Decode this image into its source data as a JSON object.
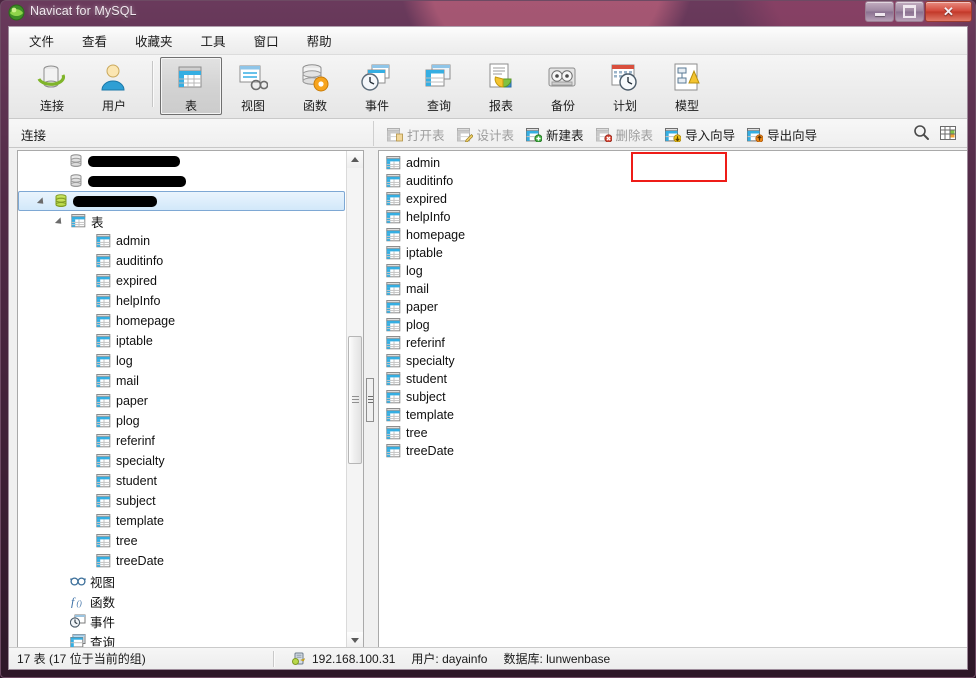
{
  "window": {
    "title": "Navicat for MySQL",
    "app_icon": "navicat-logo-icon",
    "minimize_label": "最小化",
    "restore_label": "还原",
    "close_label": "关闭"
  },
  "menubar": {
    "items": [
      {
        "label": "文件",
        "name": "menu-file"
      },
      {
        "label": "查看",
        "name": "menu-view"
      },
      {
        "label": "收藏夹",
        "name": "menu-favorites"
      },
      {
        "label": "工具",
        "name": "menu-tools"
      },
      {
        "label": "窗口",
        "name": "menu-window"
      },
      {
        "label": "帮助",
        "name": "menu-help"
      }
    ]
  },
  "toolbar": {
    "items": [
      {
        "label": "连接",
        "icon": "connection-icon",
        "selected": false
      },
      {
        "label": "用户",
        "icon": "user-icon",
        "selected": false
      },
      {
        "label": "表",
        "icon": "table-icon",
        "selected": true
      },
      {
        "label": "视图",
        "icon": "view-icon",
        "selected": false
      },
      {
        "label": "函数",
        "icon": "function-icon",
        "selected": false
      },
      {
        "label": "事件",
        "icon": "event-icon",
        "selected": false
      },
      {
        "label": "查询",
        "icon": "query-icon",
        "selected": false
      },
      {
        "label": "报表",
        "icon": "report-icon",
        "selected": false
      },
      {
        "label": "备份",
        "icon": "backup-icon",
        "selected": false
      },
      {
        "label": "计划",
        "icon": "schedule-icon",
        "selected": false
      },
      {
        "label": "模型",
        "icon": "model-icon",
        "selected": false
      }
    ]
  },
  "subbar": {
    "connection_label": "连接",
    "actions": [
      {
        "label": "打开表",
        "icon": "open-table-icon",
        "enabled": false
      },
      {
        "label": "设计表",
        "icon": "design-table-icon",
        "enabled": false
      },
      {
        "label": "新建表",
        "icon": "new-table-icon",
        "enabled": true
      },
      {
        "label": "删除表",
        "icon": "delete-table-icon",
        "enabled": false
      },
      {
        "label": "导入向导",
        "icon": "import-wizard-icon",
        "enabled": true,
        "highlighted": true
      },
      {
        "label": "导出向导",
        "icon": "export-wizard-icon",
        "enabled": true
      }
    ],
    "right_tools": [
      {
        "name": "search-icon",
        "label": "搜索"
      },
      {
        "name": "grid-view-icon",
        "label": "视图模式"
      }
    ]
  },
  "annotation": {
    "target": "导入向导",
    "color": "#ee1c18"
  },
  "tree": {
    "nodes": [
      {
        "label": "",
        "redacted": true,
        "redact_width": 92,
        "icon": "database-gray-icon",
        "indent": 50,
        "expander": false,
        "selected": false
      },
      {
        "label": "",
        "redacted": true,
        "redact_width": 98,
        "icon": "database-gray-icon",
        "indent": 50,
        "expander": false,
        "selected": false
      },
      {
        "label": "",
        "redacted": true,
        "redact_width": 84,
        "icon": "database-green-icon",
        "indent": 34,
        "expander": true,
        "selected": true
      },
      {
        "label": "表",
        "icon": "table-folder-icon",
        "indent": 52,
        "expander": true,
        "selected": false
      },
      {
        "label": "admin",
        "icon": "table-icon-small",
        "indent": 78,
        "expander": false,
        "selected": false
      },
      {
        "label": "auditinfo",
        "icon": "table-icon-small",
        "indent": 78,
        "expander": false,
        "selected": false
      },
      {
        "label": "expired",
        "icon": "table-icon-small",
        "indent": 78,
        "expander": false,
        "selected": false
      },
      {
        "label": "helpInfo",
        "icon": "table-icon-small",
        "indent": 78,
        "expander": false,
        "selected": false
      },
      {
        "label": "homepage",
        "icon": "table-icon-small",
        "indent": 78,
        "expander": false,
        "selected": false
      },
      {
        "label": "iptable",
        "icon": "table-icon-small",
        "indent": 78,
        "expander": false,
        "selected": false
      },
      {
        "label": "log",
        "icon": "table-icon-small",
        "indent": 78,
        "expander": false,
        "selected": false
      },
      {
        "label": "mail",
        "icon": "table-icon-small",
        "indent": 78,
        "expander": false,
        "selected": false
      },
      {
        "label": "paper",
        "icon": "table-icon-small",
        "indent": 78,
        "expander": false,
        "selected": false
      },
      {
        "label": "plog",
        "icon": "table-icon-small",
        "indent": 78,
        "expander": false,
        "selected": false
      },
      {
        "label": "referinf",
        "icon": "table-icon-small",
        "indent": 78,
        "expander": false,
        "selected": false
      },
      {
        "label": "specialty",
        "icon": "table-icon-small",
        "indent": 78,
        "expander": false,
        "selected": false
      },
      {
        "label": "student",
        "icon": "table-icon-small",
        "indent": 78,
        "expander": false,
        "selected": false
      },
      {
        "label": "subject",
        "icon": "table-icon-small",
        "indent": 78,
        "expander": false,
        "selected": false
      },
      {
        "label": "template",
        "icon": "table-icon-small",
        "indent": 78,
        "expander": false,
        "selected": false
      },
      {
        "label": "tree",
        "icon": "table-icon-small",
        "indent": 78,
        "expander": false,
        "selected": false
      },
      {
        "label": "treeDate",
        "icon": "table-icon-small",
        "indent": 78,
        "expander": false,
        "selected": false
      },
      {
        "label": "视图",
        "icon": "views-icon",
        "indent": 52,
        "expander": false,
        "selected": false
      },
      {
        "label": "函数",
        "icon": "functions-icon",
        "indent": 52,
        "expander": false,
        "selected": false
      },
      {
        "label": "事件",
        "icon": "events-icon",
        "indent": 52,
        "expander": false,
        "selected": false
      },
      {
        "label": "查询",
        "icon": "queries-icon",
        "indent": 52,
        "expander": false,
        "selected": false
      }
    ]
  },
  "list": {
    "items": [
      {
        "label": "admin",
        "icon": "table-icon-small"
      },
      {
        "label": "auditinfo",
        "icon": "table-icon-small"
      },
      {
        "label": "expired",
        "icon": "table-icon-small"
      },
      {
        "label": "helpInfo",
        "icon": "table-icon-small"
      },
      {
        "label": "homepage",
        "icon": "table-icon-small"
      },
      {
        "label": "iptable",
        "icon": "table-icon-small"
      },
      {
        "label": "log",
        "icon": "table-icon-small"
      },
      {
        "label": "mail",
        "icon": "table-icon-small"
      },
      {
        "label": "paper",
        "icon": "table-icon-small"
      },
      {
        "label": "plog",
        "icon": "table-icon-small"
      },
      {
        "label": "referinf",
        "icon": "table-icon-small"
      },
      {
        "label": "specialty",
        "icon": "table-icon-small"
      },
      {
        "label": "student",
        "icon": "table-icon-small"
      },
      {
        "label": "subject",
        "icon": "table-icon-small"
      },
      {
        "label": "template",
        "icon": "table-icon-small"
      },
      {
        "label": "tree",
        "icon": "table-icon-small"
      },
      {
        "label": "treeDate",
        "icon": "table-icon-small"
      }
    ]
  },
  "statusbar": {
    "count_text": "17 表 (17 位于当前的组)",
    "host_icon": "server-icon",
    "host": "192.168.100.31",
    "user": "用户: dayainfo",
    "database": "数据库: lunwenbase"
  }
}
